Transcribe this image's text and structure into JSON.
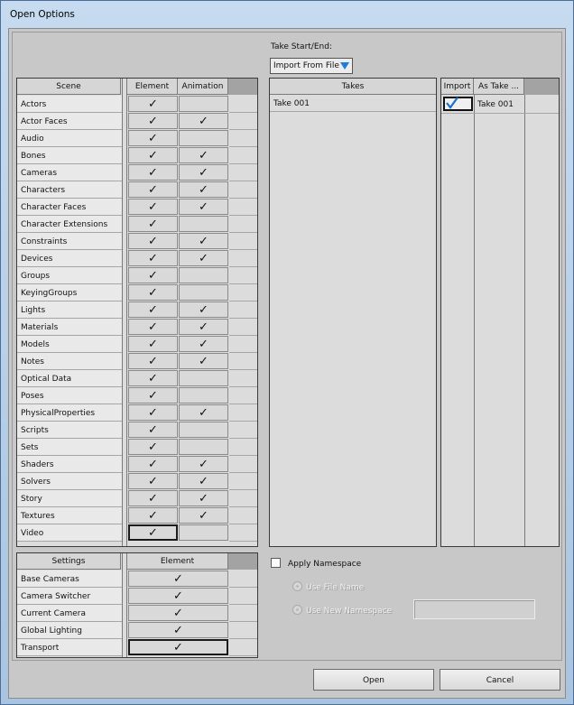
{
  "window": {
    "title": "Open Options"
  },
  "take_start_end": {
    "label": "Take Start/End:",
    "dropdown_value": "Import From File"
  },
  "scene_table": {
    "headers": {
      "name": "Scene",
      "element": "Element",
      "animation": "Animation"
    },
    "rows": [
      {
        "name": "Actors",
        "element": true,
        "animation": false
      },
      {
        "name": "Actor Faces",
        "element": true,
        "animation": true
      },
      {
        "name": "Audio",
        "element": true,
        "animation": false
      },
      {
        "name": "Bones",
        "element": true,
        "animation": true
      },
      {
        "name": "Cameras",
        "element": true,
        "animation": true
      },
      {
        "name": "Characters",
        "element": true,
        "animation": true
      },
      {
        "name": "Character Faces",
        "element": true,
        "animation": true
      },
      {
        "name": "Character Extensions",
        "element": true,
        "animation": false
      },
      {
        "name": "Constraints",
        "element": true,
        "animation": true
      },
      {
        "name": "Devices",
        "element": true,
        "animation": true
      },
      {
        "name": "Groups",
        "element": true,
        "animation": false
      },
      {
        "name": "KeyingGroups",
        "element": true,
        "animation": false
      },
      {
        "name": "Lights",
        "element": true,
        "animation": true
      },
      {
        "name": "Materials",
        "element": true,
        "animation": true
      },
      {
        "name": "Models",
        "element": true,
        "animation": true
      },
      {
        "name": "Notes",
        "element": true,
        "animation": true
      },
      {
        "name": "Optical Data",
        "element": true,
        "animation": false
      },
      {
        "name": "Poses",
        "element": true,
        "animation": false
      },
      {
        "name": "PhysicalProperties",
        "element": true,
        "animation": true
      },
      {
        "name": "Scripts",
        "element": true,
        "animation": false
      },
      {
        "name": "Sets",
        "element": true,
        "animation": false
      },
      {
        "name": "Shaders",
        "element": true,
        "animation": true
      },
      {
        "name": "Solvers",
        "element": true,
        "animation": true
      },
      {
        "name": "Story",
        "element": true,
        "animation": true
      },
      {
        "name": "Textures",
        "element": true,
        "animation": true
      },
      {
        "name": "Video",
        "element": true,
        "animation": false
      }
    ]
  },
  "settings_table": {
    "headers": {
      "name": "Settings",
      "element": "Element"
    },
    "rows": [
      {
        "name": "Base Cameras",
        "element": true
      },
      {
        "name": "Camera Switcher",
        "element": true
      },
      {
        "name": "Current Camera",
        "element": true
      },
      {
        "name": "Global Lighting",
        "element": true
      },
      {
        "name": "Transport",
        "element": true
      }
    ]
  },
  "takes_table": {
    "header": "Takes",
    "rows": [
      "Take 001"
    ]
  },
  "import_table": {
    "headers": {
      "import": "Import",
      "as_take": "As Take ..."
    },
    "rows": [
      {
        "import": true,
        "as_take": "Take 001"
      }
    ]
  },
  "namespace": {
    "apply_label": "Apply Namespace",
    "use_file_name_label": "Use File Name",
    "use_new_namespace_label": "Use New Namespace",
    "new_namespace_value": ""
  },
  "buttons": {
    "open": "Open",
    "cancel": "Cancel"
  },
  "check_glyph": "✓"
}
